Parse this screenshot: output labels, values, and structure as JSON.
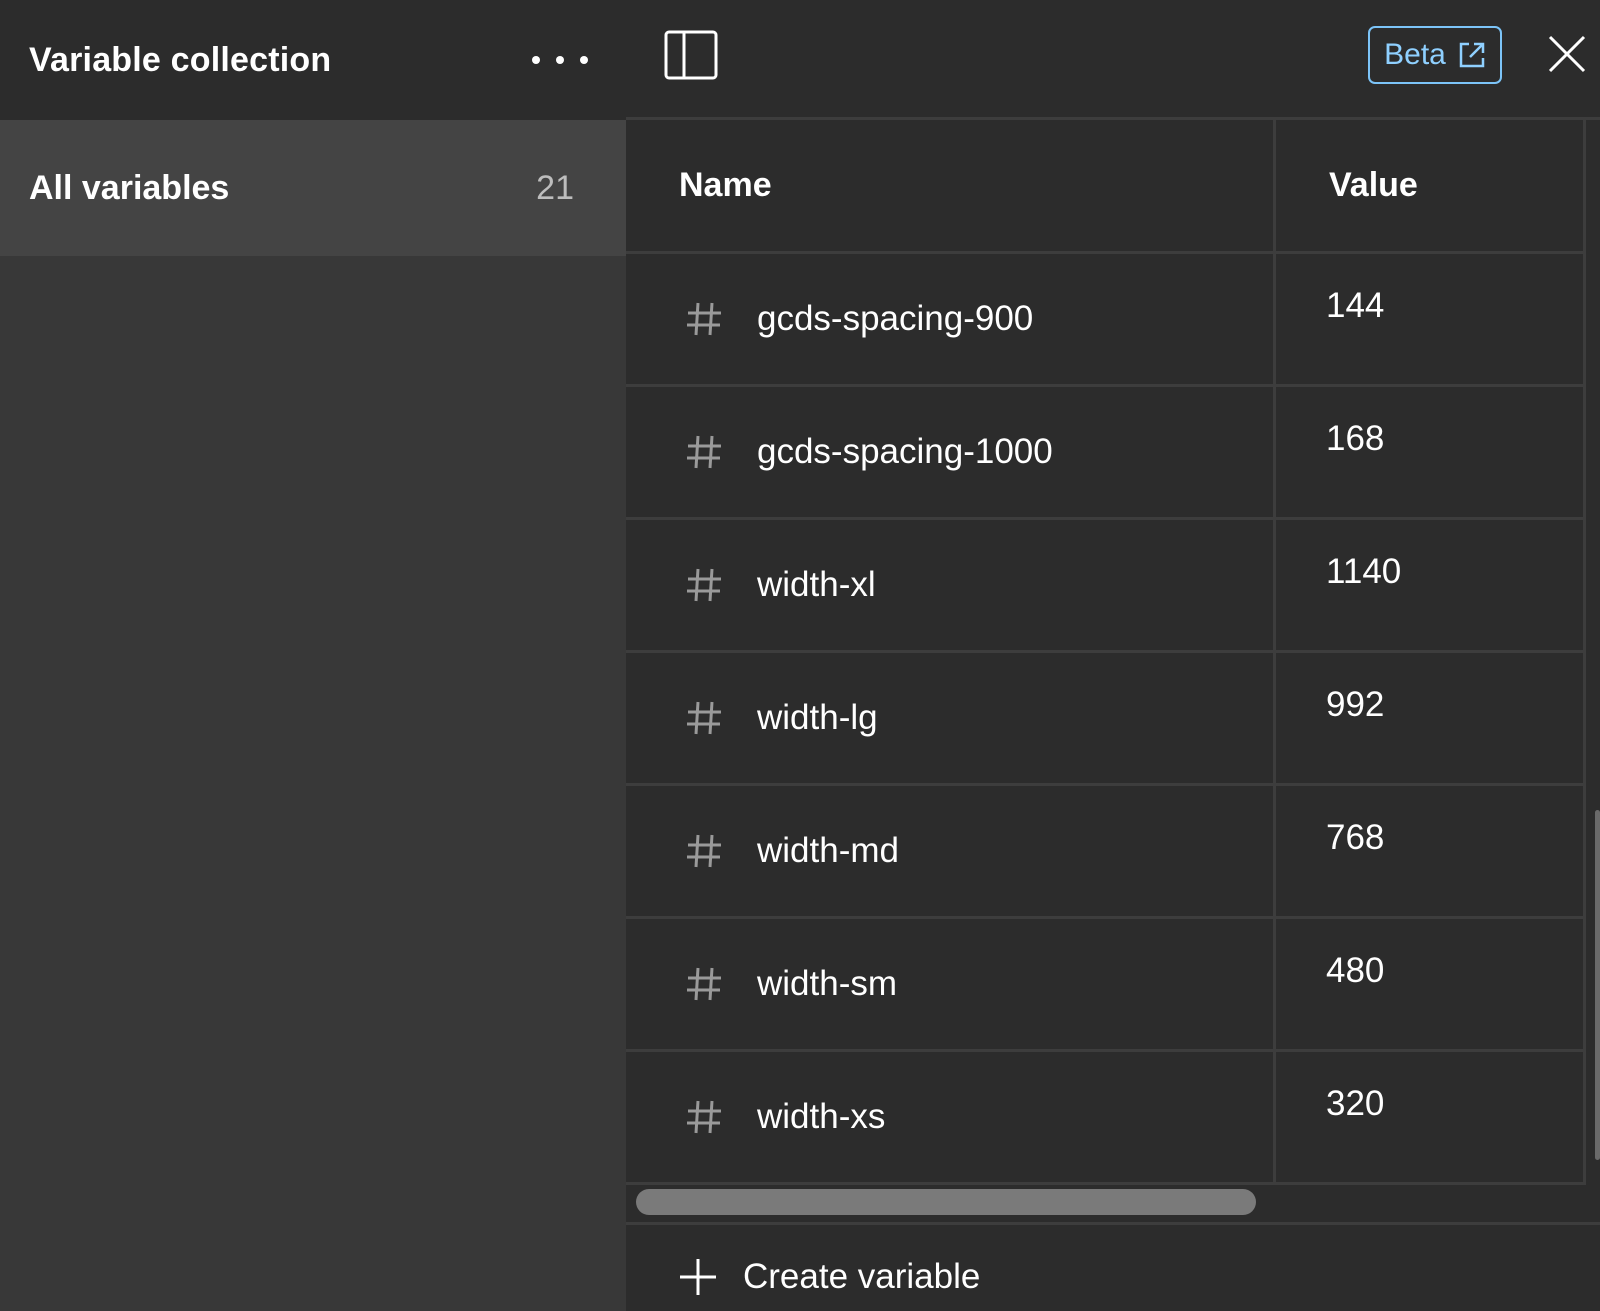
{
  "sidebar": {
    "title": "Variable collection",
    "items": [
      {
        "label": "All variables",
        "count": "21"
      }
    ]
  },
  "topbar": {
    "beta_label": "Beta"
  },
  "table": {
    "columns": [
      "Name",
      "Value"
    ],
    "rows": [
      {
        "name": "gcds-spacing-900",
        "value": "144"
      },
      {
        "name": "gcds-spacing-1000",
        "value": "168"
      },
      {
        "name": "width-xl",
        "value": "1140"
      },
      {
        "name": "width-lg",
        "value": "992"
      },
      {
        "name": "width-md",
        "value": "768"
      },
      {
        "name": "width-sm",
        "value": "480"
      },
      {
        "name": "width-xs",
        "value": "320"
      }
    ]
  },
  "footer": {
    "create_label": "Create variable"
  },
  "icons": {
    "sidebar_more": "more-horizontal-icon",
    "panel_toggle": "sidebar-panel-icon",
    "beta_external": "external-link-icon",
    "close": "close-icon",
    "variable_type": "number-hash-icon",
    "create": "plus-icon"
  },
  "colors": {
    "accent": "#7cc4f8",
    "background": "#2c2c2c",
    "sidebar": "#383838",
    "selected_item": "#444444"
  }
}
